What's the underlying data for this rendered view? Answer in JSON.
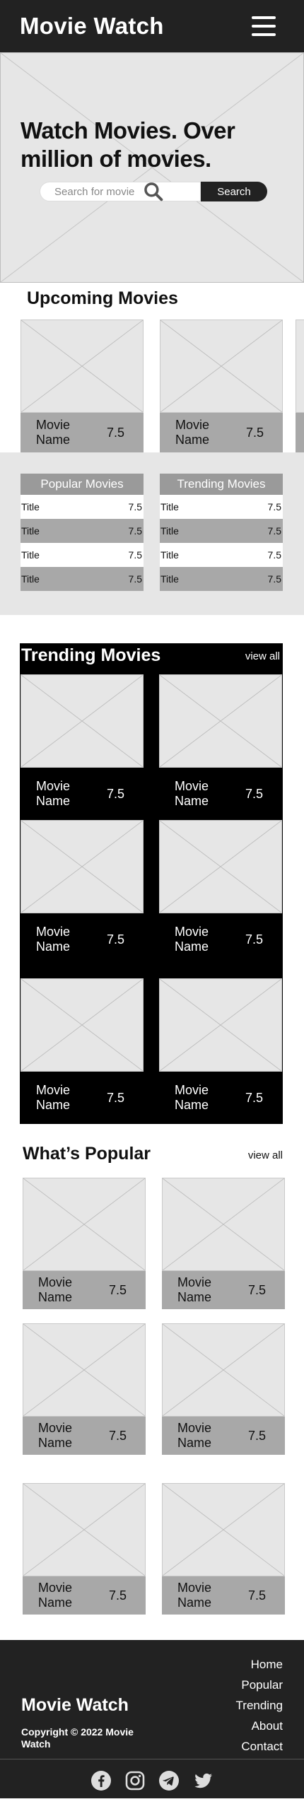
{
  "header": {
    "brand": "Movie Watch"
  },
  "hero": {
    "headline": "Watch Movies. Over million of movies.",
    "search_placeholder": "Search for movie",
    "search_button": "Search"
  },
  "upcoming": {
    "title": "Upcoming Movies",
    "cards": [
      {
        "name": "Movie Name",
        "rating": "7.5"
      },
      {
        "name": "Movie Name",
        "rating": "7.5"
      }
    ]
  },
  "lists": {
    "popular_header": "Popular Movies",
    "trending_header": "Trending Movies",
    "popular_rows": [
      {
        "title": "Title",
        "rating": "7.5"
      },
      {
        "title": "Title",
        "rating": "7.5"
      },
      {
        "title": "Title",
        "rating": "7.5"
      },
      {
        "title": "Title",
        "rating": "7.5"
      }
    ],
    "trending_rows": [
      {
        "title": "Title",
        "rating": "7.5"
      },
      {
        "title": "Title",
        "rating": "7.5"
      },
      {
        "title": "Title",
        "rating": "7.5"
      },
      {
        "title": "Title",
        "rating": "7.5"
      }
    ]
  },
  "trending": {
    "title": "Trending Movies",
    "view_all": "view all",
    "cards": [
      {
        "name": "Movie Name",
        "rating": "7.5"
      },
      {
        "name": "Movie Name",
        "rating": "7.5"
      },
      {
        "name": "Movie Name",
        "rating": "7.5"
      },
      {
        "name": "Movie Name",
        "rating": "7.5"
      },
      {
        "name": "Movie Name",
        "rating": "7.5"
      },
      {
        "name": "Movie Name",
        "rating": "7.5"
      }
    ]
  },
  "popular": {
    "title": "What’s Popular",
    "view_all": "view all",
    "cards": [
      {
        "name": "Movie Name",
        "rating": "7.5"
      },
      {
        "name": "Movie Name",
        "rating": "7.5"
      },
      {
        "name": "Movie Name",
        "rating": "7.5"
      },
      {
        "name": "Movie Name",
        "rating": "7.5"
      },
      {
        "name": "Movie Name",
        "rating": "7.5"
      },
      {
        "name": "Movie Name",
        "rating": "7.5"
      }
    ]
  },
  "footer": {
    "brand": "Movie Watch",
    "copyright": "Copyright © 2022 Movie Watch",
    "links": [
      "Home",
      "Popular",
      "Trending",
      "About",
      "Contact"
    ],
    "social_icons": [
      "facebook-icon",
      "instagram-icon",
      "telegram-icon",
      "twitter-icon"
    ]
  }
}
